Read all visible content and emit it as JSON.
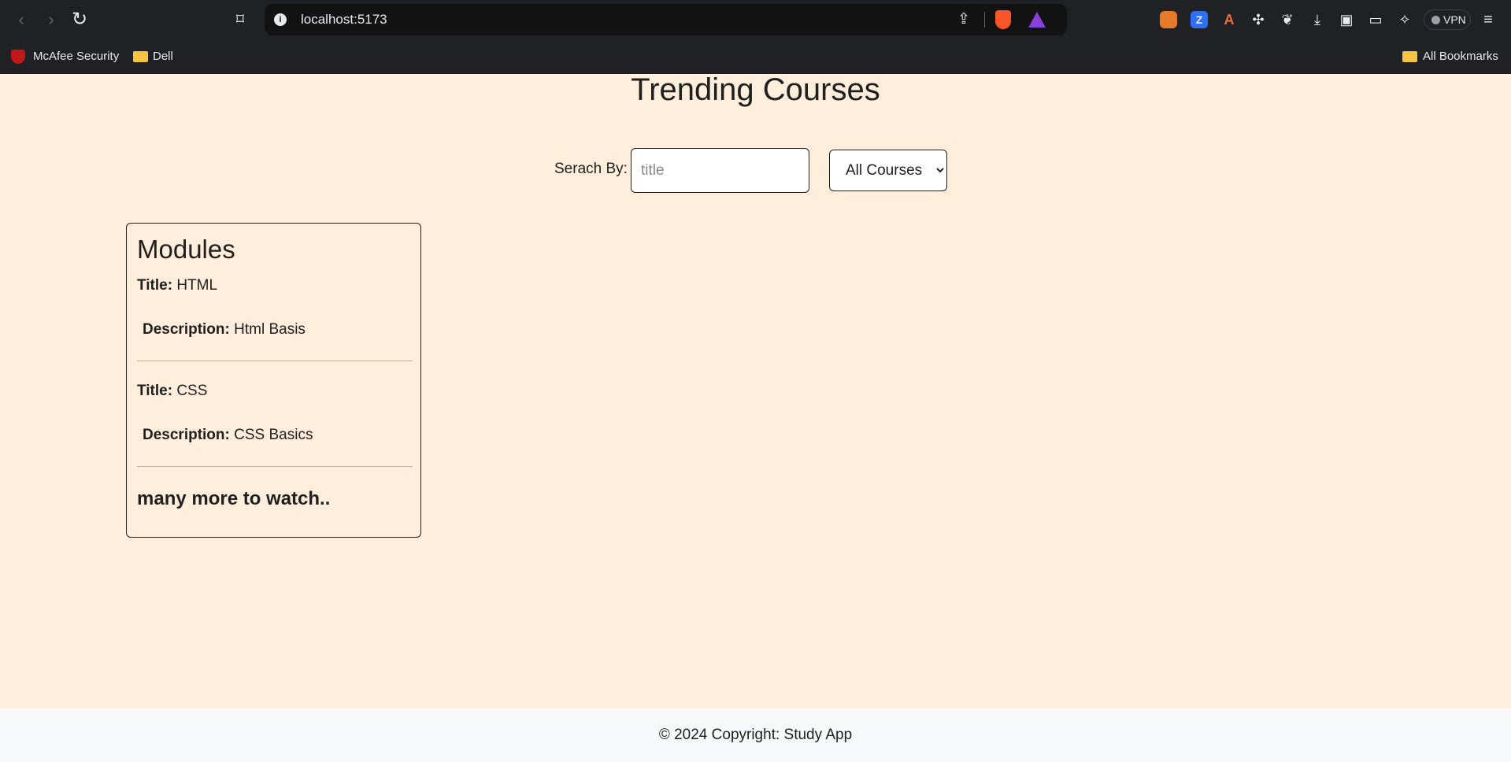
{
  "browser": {
    "url": "localhost:5173",
    "vpn_label": "VPN",
    "bookmarks": [
      {
        "label": "McAfee Security"
      },
      {
        "label": "Dell"
      }
    ],
    "all_bookmarks_label": "All Bookmarks"
  },
  "page": {
    "title": "Trending Courses",
    "search": {
      "label": "Serach By:",
      "placeholder": "title",
      "value": ""
    },
    "filter": {
      "selected": "All Courses"
    },
    "card": {
      "heading": "Modules",
      "modules": [
        {
          "title_label": "Title:",
          "title": "HTML",
          "desc_label": "Description:",
          "description": "Html Basis"
        },
        {
          "title_label": "Title:",
          "title": "CSS",
          "desc_label": "Description:",
          "description": "CSS Basics"
        }
      ],
      "more_text": "many more to watch.."
    },
    "footer": "© 2024 Copyright: Study App"
  }
}
